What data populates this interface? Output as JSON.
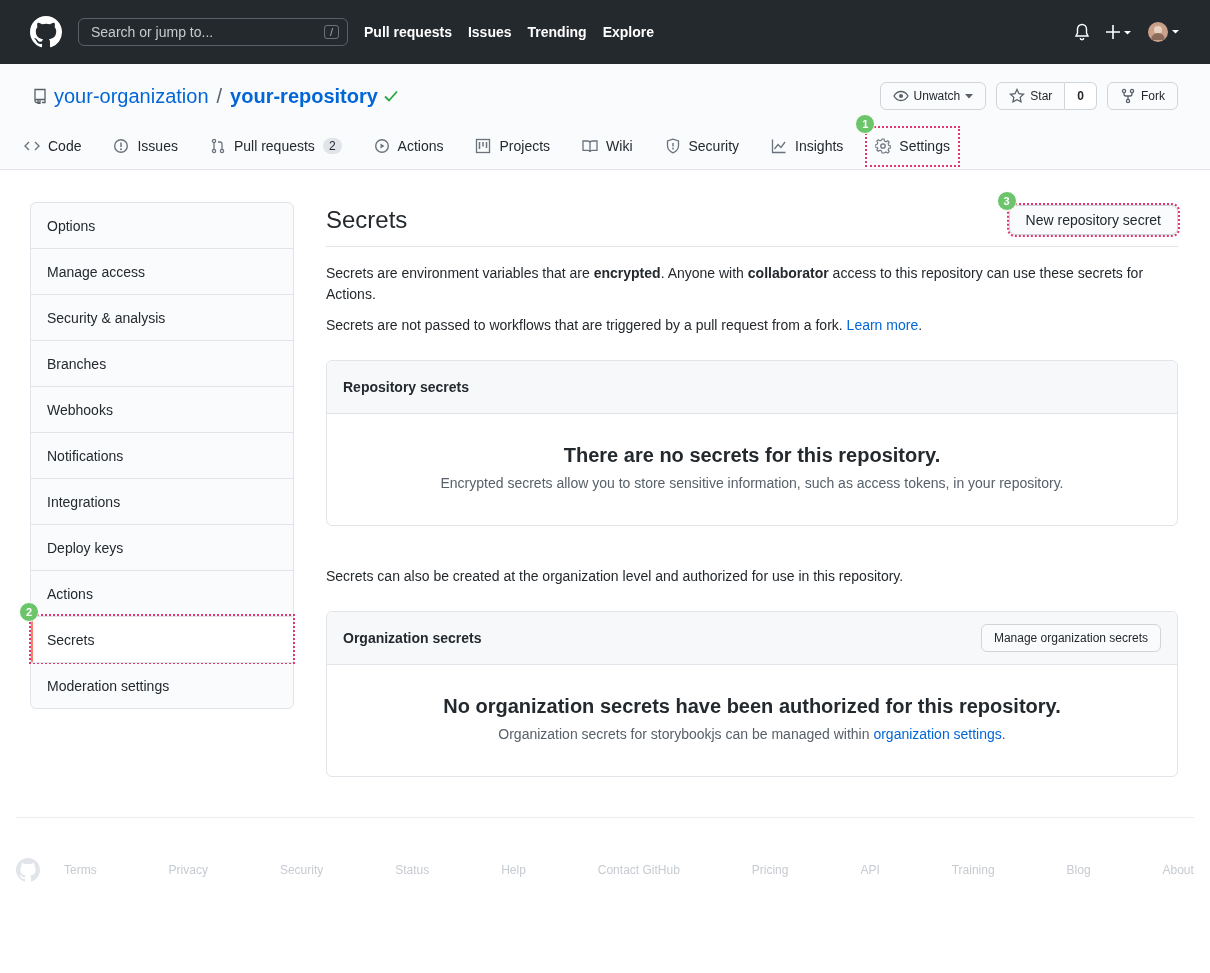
{
  "header": {
    "search_placeholder": "Search or jump to...",
    "search_key": "/",
    "nav": [
      "Pull requests",
      "Issues",
      "Trending",
      "Explore"
    ]
  },
  "repo": {
    "owner": "your-organization",
    "separator": "/",
    "name": "your-repository",
    "actions": [
      {
        "kind": "watch",
        "label": "Unwatch"
      },
      {
        "kind": "star",
        "label": "Star",
        "count": "0"
      },
      {
        "kind": "fork",
        "label": "Fork"
      }
    ]
  },
  "tabs": [
    {
      "kind": "code",
      "label": "Code",
      "selected": false
    },
    {
      "kind": "issue",
      "label": "Issues",
      "selected": false
    },
    {
      "kind": "pr",
      "label": "Pull requests",
      "counter": "2",
      "selected": false
    },
    {
      "kind": "play",
      "label": "Actions",
      "selected": false
    },
    {
      "kind": "project",
      "label": "Projects",
      "selected": false
    },
    {
      "kind": "book",
      "label": "Wiki",
      "selected": false
    },
    {
      "kind": "shield",
      "label": "Security",
      "selected": false
    },
    {
      "kind": "graph",
      "label": "Insights",
      "selected": false
    },
    {
      "kind": "gear",
      "label": "Settings",
      "selected": false,
      "callout": "1"
    }
  ],
  "sidebar": {
    "items": [
      {
        "label": "Options",
        "selected": false
      },
      {
        "label": "Manage access",
        "selected": false
      },
      {
        "label": "Security & analysis",
        "selected": false
      },
      {
        "label": "Branches",
        "selected": false
      },
      {
        "label": "Webhooks",
        "selected": false
      },
      {
        "label": "Notifications",
        "selected": false
      },
      {
        "label": "Integrations",
        "selected": false
      },
      {
        "label": "Deploy keys",
        "selected": false
      },
      {
        "label": "Actions",
        "selected": false
      },
      {
        "label": "Secrets",
        "selected": true,
        "callout": "2"
      },
      {
        "label": "Moderation settings",
        "selected": false
      }
    ]
  },
  "main": {
    "title": "Secrets",
    "new_button": {
      "label": "New repository secret",
      "callout": "3"
    },
    "intro": "Secrets are environment variables that are **encrypted**. Anyone with **collaborator** access to this repository can use these secrets for Actions.",
    "fork_note": {
      "text": "Secrets are not passed to workflows that are triggered by a pull request from a fork. ",
      "link": "Learn more",
      "after": "."
    },
    "repo_box": {
      "heading": "Repository secrets",
      "blank_title": "There are no secrets for this repository.",
      "blank_text": {
        "text": "Encrypted secrets allow you to store sensitive information, such as access tokens, in your repository."
      }
    },
    "org_note": "Secrets can also be created at the organization level and authorized for use in this repository.",
    "org_box": {
      "heading": "Organization secrets",
      "button": "Manage organization secrets",
      "blank_title": "No organization secrets have been authorized for this repository.",
      "blank_text": {
        "text": "Organization secrets for storybookjs can be managed within ",
        "link": "organization settings",
        "after": "."
      }
    }
  },
  "footer": [
    "Terms",
    "Privacy",
    "Security",
    "Status",
    "Help",
    "Contact GitHub",
    "Pricing",
    "API",
    "Training",
    "Blog",
    "About"
  ]
}
